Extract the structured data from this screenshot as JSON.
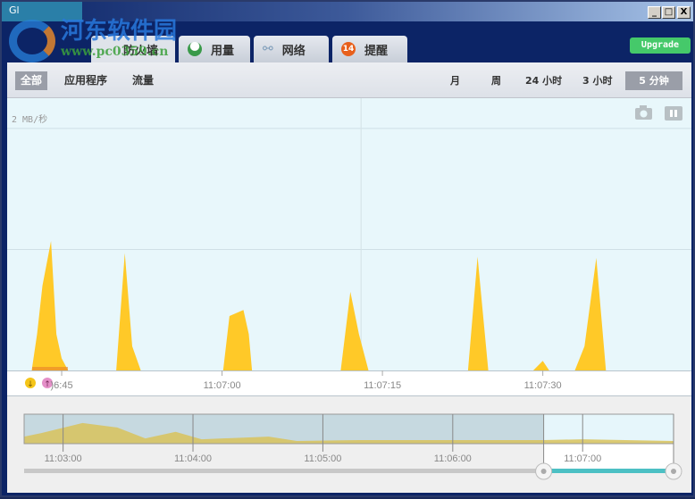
{
  "window": {
    "logo_text": "Gl",
    "controls": {
      "minimize": "_",
      "maximize": "□",
      "close": "X"
    }
  },
  "watermark": {
    "title": "河东软件园",
    "url": "www.pc0359.cn"
  },
  "tabs": [
    {
      "label": "防火墙",
      "icon": "firewall-icon"
    },
    {
      "label": "用量",
      "icon": "usage-pie-icon",
      "icon_color": "#3a9a4a"
    },
    {
      "label": "网络",
      "icon": "network-icon"
    },
    {
      "label": "提醒",
      "icon": "alert-badge-icon",
      "badge": "14",
      "badge_color": "#e8601c"
    }
  ],
  "upgrade_label": "Upgrade",
  "filters": [
    {
      "label": "全部",
      "selected": true
    },
    {
      "label": "应用程序"
    },
    {
      "label": "流量"
    }
  ],
  "ranges": [
    {
      "label": "月"
    },
    {
      "label": "周"
    },
    {
      "label": "24 小时"
    },
    {
      "label": "3 小时"
    },
    {
      "label": "5 分钟",
      "selected": true
    }
  ],
  "chart_icons": [
    "camera-icon",
    "pause-icon"
  ],
  "legend": [
    {
      "name": "download",
      "icon": "download-arrow-icon",
      "color": "#f5c518"
    },
    {
      "name": "upload",
      "icon": "upload-arrow-icon",
      "color": "#e48fc8"
    }
  ],
  "chart_data": {
    "type": "area",
    "ylabel": "2 MB/秒",
    "yticks": [
      1,
      2
    ],
    "ylim": [
      0,
      2.25
    ],
    "xlim": [
      "11:06:39.9",
      "11:07:43.9"
    ],
    "xticks": [
      "11:06:45",
      "11:07:00",
      "11:07:15",
      "11:07:30"
    ],
    "xtick_labels": [
      ")6:45",
      "11:07:00",
      "11:07:15",
      "11:07:30"
    ],
    "series": [
      {
        "color": "#ffc928",
        "points": [
          [
            "11:06:42.2",
            0
          ],
          [
            "11:06:42.7",
            0.3
          ],
          [
            "11:06:43.2",
            0.7
          ],
          [
            "11:06:44.0",
            1.07
          ],
          [
            "11:06:44.5",
            0.3
          ],
          [
            "11:06:45.0",
            0.1
          ],
          [
            "11:06:45.6",
            0
          ],
          [
            "11:06:50.1",
            0
          ],
          [
            "11:06:50.9",
            0.97
          ],
          [
            "11:06:51.6",
            0.2
          ],
          [
            "11:06:52.4",
            0
          ],
          [
            "11:07:00.1",
            0
          ],
          [
            "11:07:00.7",
            0.45
          ],
          [
            "11:07:02.0",
            0.5
          ],
          [
            "11:07:02.5",
            0.3
          ],
          [
            "11:07:02.8",
            0
          ],
          [
            "11:07:11.1",
            0
          ],
          [
            "11:07:12.0",
            0.65
          ],
          [
            "11:07:12.8",
            0.3
          ],
          [
            "11:07:13.7",
            0
          ],
          [
            "11:07:23.0",
            0
          ],
          [
            "11:07:23.9",
            0.94
          ],
          [
            "11:07:24.9",
            0
          ],
          [
            "11:07:29.1",
            0
          ],
          [
            "11:07:30.0",
            0.08
          ],
          [
            "11:07:30.6",
            0
          ],
          [
            "11:07:33.0",
            0
          ],
          [
            "11:07:33.9",
            0.2
          ],
          [
            "11:07:35.0",
            0.93
          ],
          [
            "11:07:35.9",
            0
          ]
        ]
      }
    ],
    "cursor": "11:07:13",
    "overview": {
      "xlim": [
        "11:02:42",
        "11:07:42"
      ],
      "xticks": [
        "11:03:00",
        "11:04:00",
        "11:05:00",
        "11:06:00",
        "11:07:00"
      ],
      "selection": [
        "11:06:42",
        "11:07:42"
      ],
      "levels": [
        [
          "11:02:42",
          0.24
        ],
        [
          "11:02:50",
          0.36
        ],
        [
          "11:03:09",
          0.7
        ],
        [
          "11:03:25",
          0.55
        ],
        [
          "11:03:38",
          0.18
        ],
        [
          "11:03:52",
          0.4
        ],
        [
          "11:04:04",
          0.15
        ],
        [
          "11:04:35",
          0.24
        ],
        [
          "11:04:48",
          0.09
        ],
        [
          "11:05:17",
          0.12
        ],
        [
          "11:06:42",
          0.12
        ],
        [
          "11:07:00",
          0.15
        ],
        [
          "11:07:42",
          0.09
        ]
      ]
    }
  }
}
